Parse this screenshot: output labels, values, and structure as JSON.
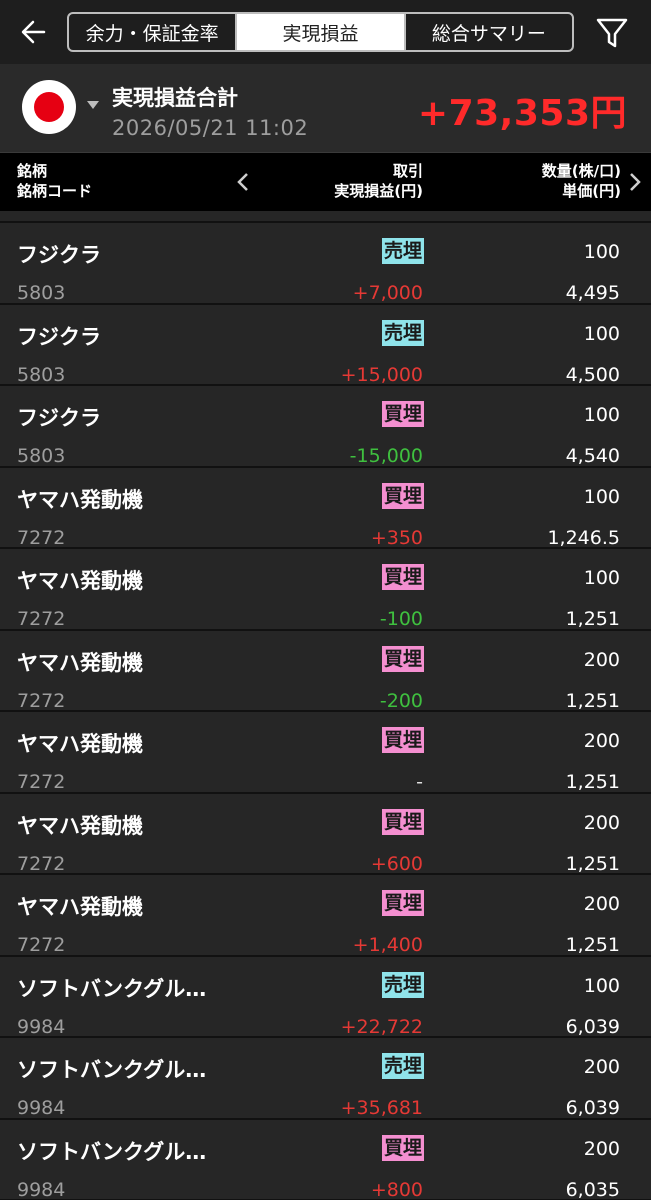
{
  "header": {
    "tabs": [
      {
        "label": "余力・保証金率",
        "active": false
      },
      {
        "label": "実現損益",
        "active": true
      },
      {
        "label": "総合サマリー",
        "active": false
      }
    ]
  },
  "summary": {
    "title": "実現損益合計",
    "datetime": "2026/05/21  11:02",
    "total": "+73,353円",
    "market_flag": "japan-flag-icon"
  },
  "table": {
    "col1_line1": "銘柄",
    "col1_line2": "銘柄コード",
    "col2_line1": "取引",
    "col2_line2": "実現損益(円)",
    "col3_line1": "数量(株/口)",
    "col3_line2": "単価(円)",
    "rows": [
      {
        "name": "フジクラ",
        "code": "5803",
        "trade": "売埋",
        "pnl": "+7,000",
        "qty": "100",
        "price": "4,495"
      },
      {
        "name": "フジクラ",
        "code": "5803",
        "trade": "売埋",
        "pnl": "+15,000",
        "qty": "100",
        "price": "4,500"
      },
      {
        "name": "フジクラ",
        "code": "5803",
        "trade": "買埋",
        "pnl": "-15,000",
        "qty": "100",
        "price": "4,540"
      },
      {
        "name": "ヤマハ発動機",
        "code": "7272",
        "trade": "買埋",
        "pnl": "+350",
        "qty": "100",
        "price": "1,246.5"
      },
      {
        "name": "ヤマハ発動機",
        "code": "7272",
        "trade": "買埋",
        "pnl": "-100",
        "qty": "100",
        "price": "1,251"
      },
      {
        "name": "ヤマハ発動機",
        "code": "7272",
        "trade": "買埋",
        "pnl": "-200",
        "qty": "200",
        "price": "1,251"
      },
      {
        "name": "ヤマハ発動機",
        "code": "7272",
        "trade": "買埋",
        "pnl": "-",
        "qty": "200",
        "price": "1,251"
      },
      {
        "name": "ヤマハ発動機",
        "code": "7272",
        "trade": "買埋",
        "pnl": "+600",
        "qty": "200",
        "price": "1,251"
      },
      {
        "name": "ヤマハ発動機",
        "code": "7272",
        "trade": "買埋",
        "pnl": "+1,400",
        "qty": "200",
        "price": "1,251"
      },
      {
        "name": "ソフトバンクグル…",
        "code": "9984",
        "trade": "売埋",
        "pnl": "+22,722",
        "qty": "100",
        "price": "6,039"
      },
      {
        "name": "ソフトバンクグル…",
        "code": "9984",
        "trade": "売埋",
        "pnl": "+35,681",
        "qty": "200",
        "price": "6,039"
      },
      {
        "name": "ソフトバンクグル…",
        "code": "9984",
        "trade": "買埋",
        "pnl": "+800",
        "qty": "200",
        "price": "6,035"
      }
    ]
  },
  "colors": {
    "profit": "#e53935",
    "loss": "#3fc03f",
    "sell_badge": "#8fe3ea",
    "buy_badge": "#f48fd0",
    "total": "#ff2a2a"
  }
}
